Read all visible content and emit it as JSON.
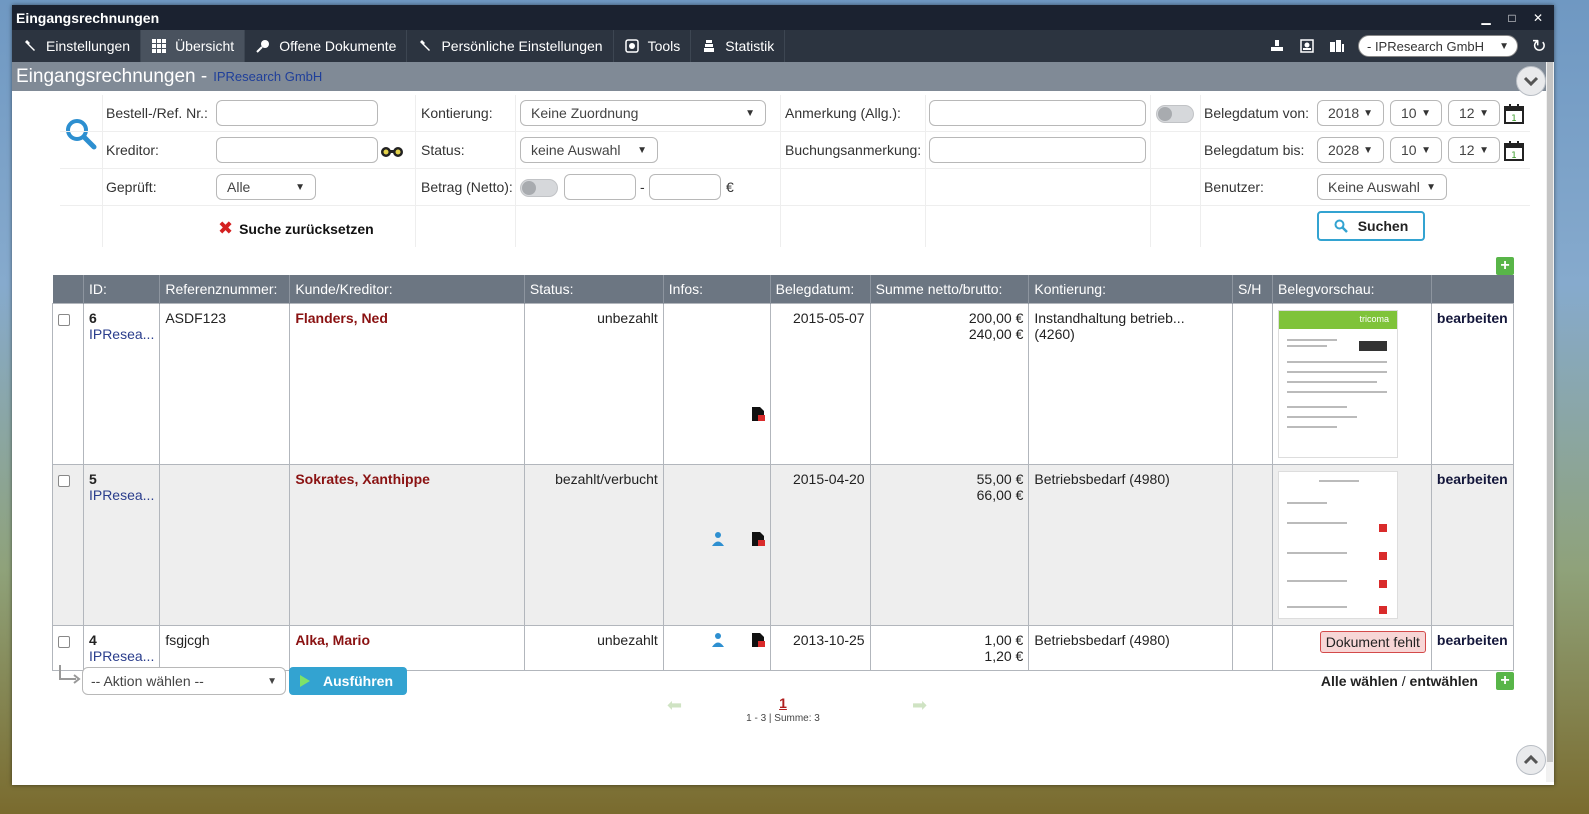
{
  "window": {
    "title": "Eingangsrechnungen",
    "controls": [
      "▁",
      "□",
      "✕"
    ]
  },
  "menu": {
    "items": [
      {
        "label": "Einstellungen",
        "icon": "wrench-icon"
      },
      {
        "label": "Übersicht",
        "icon": "grid-icon",
        "active": true
      },
      {
        "label": "Offene Dokumente",
        "icon": "pin-icon"
      },
      {
        "label": "Persönliche Einstellungen",
        "icon": "wrench-icon"
      },
      {
        "label": "Tools",
        "icon": "tools-icon"
      },
      {
        "label": "Statistik",
        "icon": "stats-icon"
      }
    ],
    "company": "- IPResearch GmbH"
  },
  "page": {
    "title": "Eingangsrechnungen -",
    "company": "IPResearch GmbH"
  },
  "filters": {
    "bestell_label": "Bestell-/Ref. Nr.:",
    "kreditor_label": "Kreditor:",
    "geprueft_label": "Geprüft:",
    "geprueft_value": "Alle",
    "kontierung_label": "Kontierung:",
    "kontierung_value": "Keine Zuordnung",
    "status_label": "Status:",
    "status_value": "keine Auswahl",
    "betrag_label": "Betrag (Netto):",
    "betrag_sep": "-",
    "betrag_currency": "€",
    "anmerkung_label": "Anmerkung (Allg.):",
    "buchung_label": "Buchungsanmerkung:",
    "von_label": "Belegdatum von:",
    "von": {
      "year": "2018",
      "month": "10",
      "day": "12"
    },
    "bis_label": "Belegdatum bis:",
    "bis": {
      "year": "2028",
      "month": "10",
      "day": "12"
    },
    "benutzer_label": "Benutzer:",
    "benutzer_value": "Keine Auswahl",
    "reset_label": "Suche zurücksetzen",
    "search_label": "Suchen"
  },
  "table": {
    "headers": [
      "ID:",
      "Referenznummer:",
      "Kunde/Kreditor:",
      "Status:",
      "Infos:",
      "Belegdatum:",
      "Summe netto/brutto:",
      "Kontierung:",
      "S/H",
      "Belegvorschau:",
      ""
    ],
    "rows": [
      {
        "id": "6",
        "company": "IPResea...",
        "ref": "ASDF123",
        "kunde": "Flanders, Ned",
        "status": "unbezahlt",
        "date": "2015-05-07",
        "netto": "200,00 €",
        "brutto": "240,00 €",
        "kontierung": "Instandhaltung betrieb... (4260)",
        "preview_brand": "tricoma",
        "edit": "bearbeiten"
      },
      {
        "id": "5",
        "company": "IPResea...",
        "ref": "",
        "kunde": "Sokrates, Xanthippe",
        "status": "bezahlt/verbucht",
        "date": "2015-04-20",
        "netto": "55,00 €",
        "brutto": "66,00 €",
        "kontierung": "Betriebsbedarf (4980)",
        "edit": "bearbeiten"
      },
      {
        "id": "4",
        "company": "IPResea...",
        "ref": "fsgjcgh",
        "kunde": "Alka, Mario",
        "status": "unbezahlt",
        "date": "2013-10-25",
        "netto": "1,00 €",
        "brutto": "1,20 €",
        "kontierung": "Betriebsbedarf (4980)",
        "missing": "Dokument fehlt",
        "edit": "bearbeiten"
      }
    ]
  },
  "bottom": {
    "action_placeholder": "-- Aktion wählen --",
    "run_label": "Ausführen",
    "select_all": "Alle wählen",
    "select_sep": " / ",
    "deselect": "entwählen"
  },
  "pager": {
    "page": "1",
    "summary": "1 - 3 | Summe: 3"
  }
}
